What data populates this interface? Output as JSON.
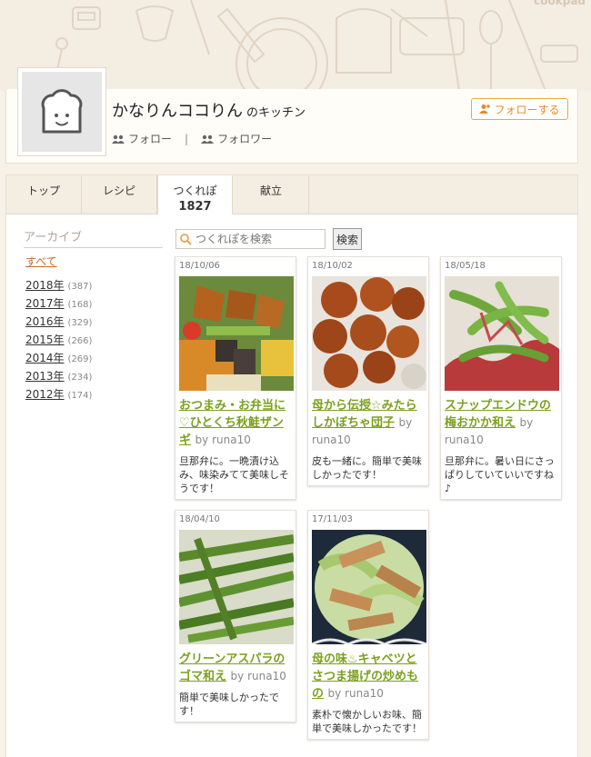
{
  "brand": "cookpad",
  "kitchen": {
    "name": "かなりんココりん",
    "suffix": "のキッチン",
    "follow_label": "フォロー",
    "follower_label": "フォロワー",
    "separator": "|",
    "follow_button": "フォローする"
  },
  "tabs": [
    {
      "label": "トップ",
      "count": ""
    },
    {
      "label": "レシピ",
      "count": ""
    },
    {
      "label": "つくれぽ",
      "count": "1827"
    },
    {
      "label": "献立",
      "count": ""
    }
  ],
  "archive": {
    "title": "アーカイブ",
    "all": "すべて",
    "years": [
      {
        "year": "2018年",
        "count": "(387)"
      },
      {
        "year": "2017年",
        "count": "(168)"
      },
      {
        "year": "2016年",
        "count": "(329)"
      },
      {
        "year": "2015年",
        "count": "(266)"
      },
      {
        "year": "2014年",
        "count": "(269)"
      },
      {
        "year": "2013年",
        "count": "(234)"
      },
      {
        "year": "2012年",
        "count": "(174)"
      }
    ]
  },
  "search": {
    "placeholder": "つくれぽを検索",
    "button": "検索"
  },
  "cards": [
    {
      "date": "18/10/06",
      "title": "おつまみ・お弁当に♡ひとくち秋鮭ザンギ",
      "author": "by runa10",
      "desc": "旦那弁に。一晩漬け込み、味染みてて美味しそうです！"
    },
    {
      "date": "18/10/02",
      "title": "母から伝授☆みたらしかぼちゃ団子",
      "author": "by runa10",
      "desc": "皮も一緒に。簡単で美味しかったです！"
    },
    {
      "date": "18/05/18",
      "title": "スナップエンドウの梅おかか和え",
      "author": "by runa10",
      "desc": "旦那弁に。暑い日にさっぱりしていていいですね♪"
    },
    {
      "date": "18/04/10",
      "title": "グリーンアスパラのゴマ和え",
      "author": "by runa10",
      "desc": "簡単で美味しかったです！"
    },
    {
      "date": "17/11/03",
      "title": "母の味♨キャベツとさつま揚げの炒めもの",
      "author": "by runa10",
      "desc": "素朴で懐かしいお味、簡単で美味しかったです！"
    }
  ]
}
